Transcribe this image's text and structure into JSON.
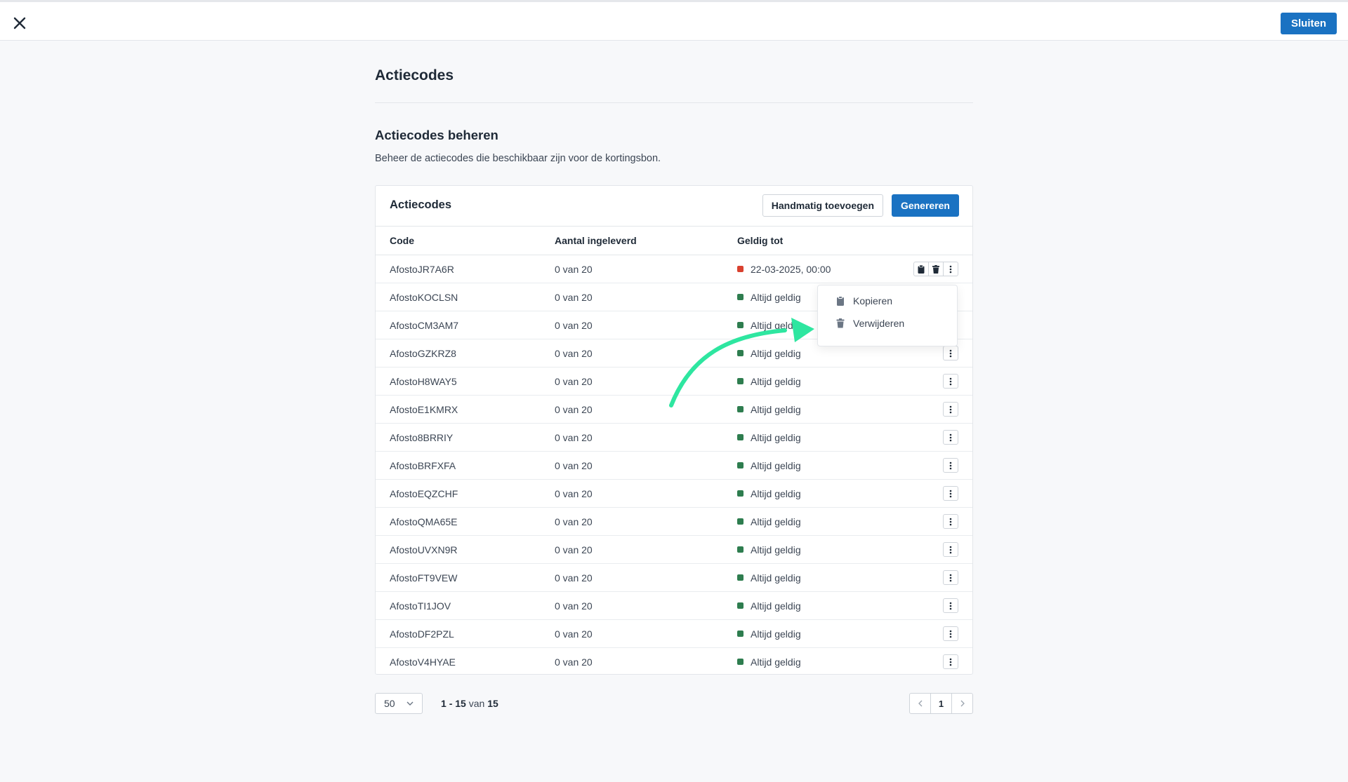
{
  "header": {
    "close_icon": "close-icon",
    "close_button_label": "Sluiten"
  },
  "page": {
    "title": "Actiecodes",
    "section_title": "Actiecodes beheren",
    "section_description": "Beheer de actiecodes die beschikbaar zijn voor de kortingsbon."
  },
  "card": {
    "title": "Actiecodes",
    "add_manual_label": "Handmatig toevoegen",
    "generate_label": "Genereren",
    "columns": {
      "code": "Code",
      "delivered": "Aantal ingeleverd",
      "valid_until": "Geldig tot"
    },
    "rows": [
      {
        "code": "AfostoJR7A6R",
        "delivered": "0 van 20",
        "valid": "22-03-2025, 00:00",
        "status": "expired"
      },
      {
        "code": "AfostoKOCLSN",
        "delivered": "0 van 20",
        "valid": "Altijd geldig",
        "status": "valid"
      },
      {
        "code": "AfostoCM3AM7",
        "delivered": "0 van 20",
        "valid": "Altijd geldig",
        "status": "valid"
      },
      {
        "code": "AfostoGZKRZ8",
        "delivered": "0 van 20",
        "valid": "Altijd geldig",
        "status": "valid"
      },
      {
        "code": "AfostoH8WAY5",
        "delivered": "0 van 20",
        "valid": "Altijd geldig",
        "status": "valid"
      },
      {
        "code": "AfostoE1KMRX",
        "delivered": "0 van 20",
        "valid": "Altijd geldig",
        "status": "valid"
      },
      {
        "code": "Afosto8BRRIY",
        "delivered": "0 van 20",
        "valid": "Altijd geldig",
        "status": "valid"
      },
      {
        "code": "AfostoBRFXFA",
        "delivered": "0 van 20",
        "valid": "Altijd geldig",
        "status": "valid"
      },
      {
        "code": "AfostoEQZCHF",
        "delivered": "0 van 20",
        "valid": "Altijd geldig",
        "status": "valid"
      },
      {
        "code": "AfostoQMA65E",
        "delivered": "0 van 20",
        "valid": "Altijd geldig",
        "status": "valid"
      },
      {
        "code": "AfostoUVXN9R",
        "delivered": "0 van 20",
        "valid": "Altijd geldig",
        "status": "valid"
      },
      {
        "code": "AfostoFT9VEW",
        "delivered": "0 van 20",
        "valid": "Altijd geldig",
        "status": "valid"
      },
      {
        "code": "AfostoTI1JOV",
        "delivered": "0 van 20",
        "valid": "Altijd geldig",
        "status": "valid"
      },
      {
        "code": "AfostoDF2PZL",
        "delivered": "0 van 20",
        "valid": "Altijd geldig",
        "status": "valid"
      },
      {
        "code": "AfostoV4HYAE",
        "delivered": "0 van 20",
        "valid": "Altijd geldig",
        "status": "valid"
      }
    ]
  },
  "dropdown_menu": {
    "copy_label": "Kopieren",
    "delete_label": "Verwijderen"
  },
  "pagination": {
    "per_page": "50",
    "range_start": "1",
    "range_end": "15",
    "range_of": "van",
    "total": "15",
    "current_page": "1"
  },
  "colors": {
    "primary": "#1a72c2",
    "status_expired": "#d9412f",
    "status_valid": "#2e7d4f",
    "annotation_arrow": "#2ee6a0"
  }
}
